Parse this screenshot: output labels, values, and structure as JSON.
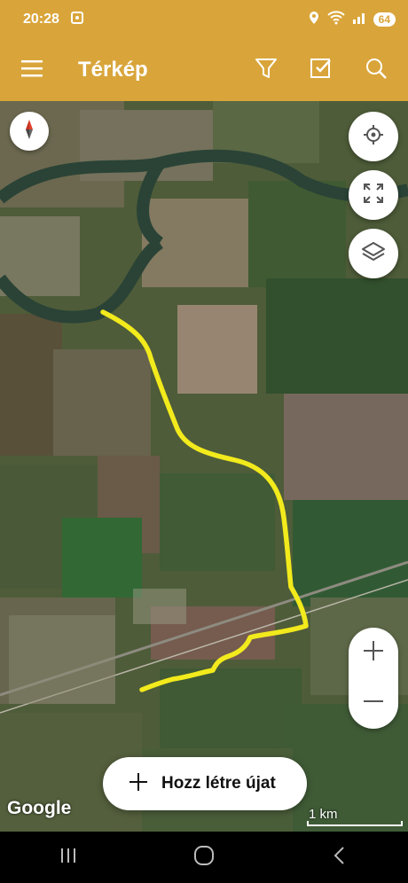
{
  "status_bar": {
    "time": "20:28",
    "battery": "64"
  },
  "app_bar": {
    "title": "Térkép",
    "icons": [
      "menu-icon",
      "filter-icon",
      "checkbox-icon",
      "search-icon"
    ]
  },
  "map": {
    "attribution": "Google",
    "scale_label": "1 km",
    "track_color": "#f2ea1c"
  },
  "controls": {
    "create_label": "Hozz létre újat",
    "zoom_in": "+",
    "zoom_out": "−"
  },
  "colors": {
    "accent": "#d9a53a",
    "track": "#f2ea1c"
  }
}
